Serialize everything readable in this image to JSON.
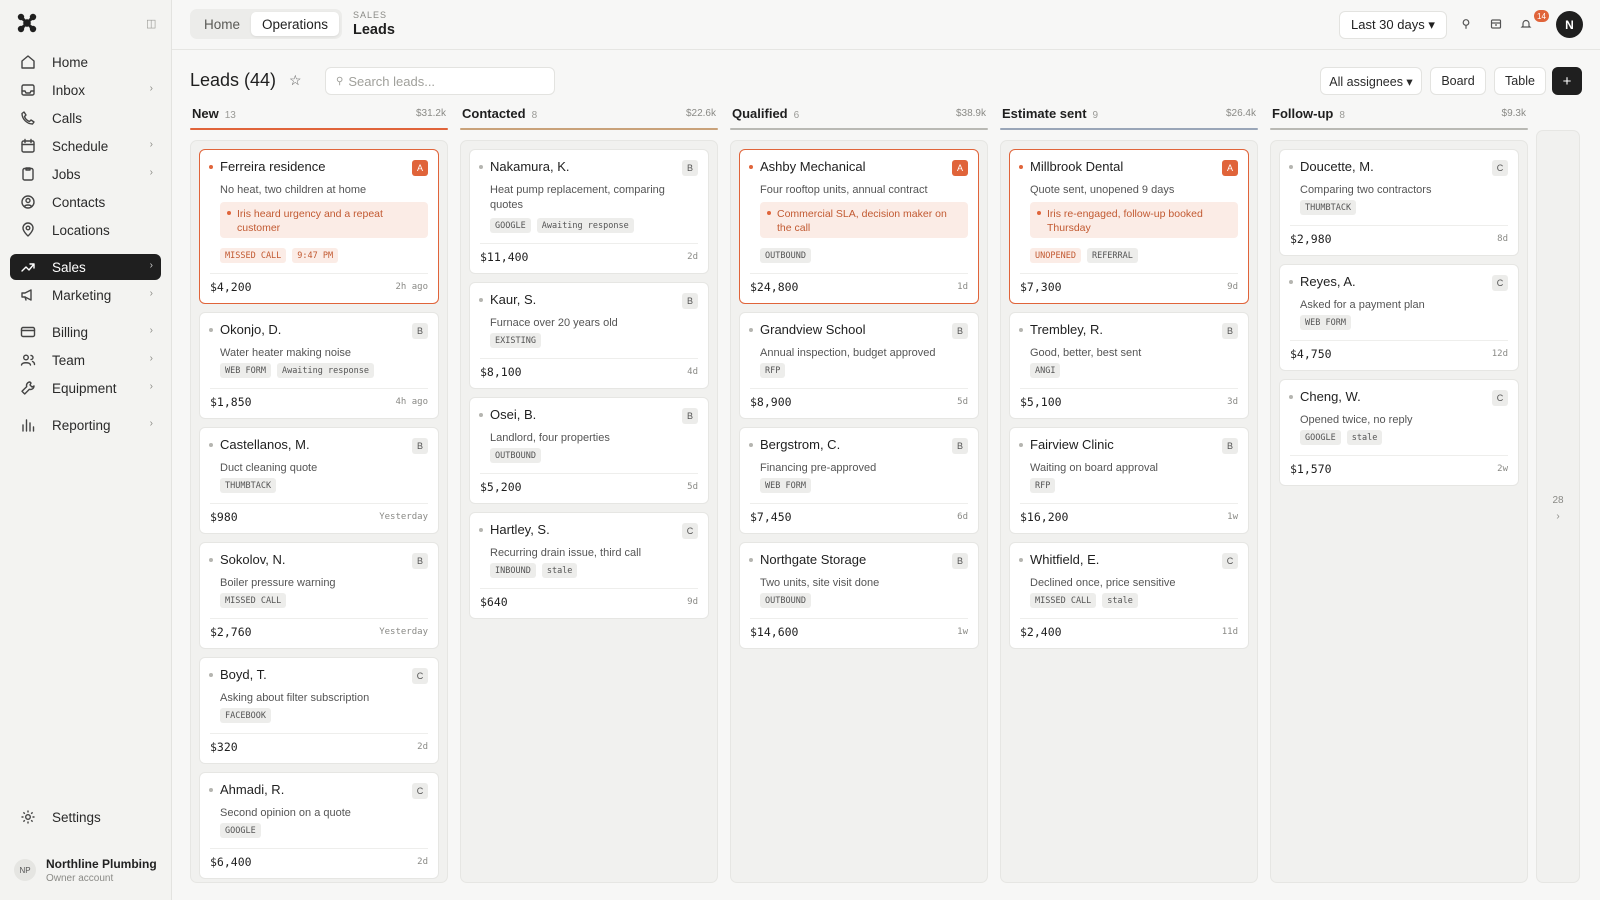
{
  "sidebar": {
    "nav": [
      {
        "label": "Home",
        "icon": "home-icon",
        "chevron": false
      },
      {
        "label": "Inbox",
        "icon": "inbox-icon",
        "chevron": true
      },
      {
        "label": "Calls",
        "icon": "phone-icon",
        "chevron": false
      },
      {
        "label": "Schedule",
        "icon": "calendar-icon",
        "chevron": true
      },
      {
        "label": "Jobs",
        "icon": "clipboard-icon",
        "chevron": true
      },
      {
        "label": "Contacts",
        "icon": "contacts-icon",
        "chevron": false
      },
      {
        "label": "Locations",
        "icon": "pin-icon",
        "chevron": false
      },
      {
        "label": "Sales",
        "icon": "trend-icon",
        "chevron": true,
        "active": true
      },
      {
        "label": "Marketing",
        "icon": "megaphone-icon",
        "chevron": true
      },
      {
        "label": "Billing",
        "icon": "card-icon",
        "chevron": true
      },
      {
        "label": "Team",
        "icon": "team-icon",
        "chevron": true
      },
      {
        "label": "Equipment",
        "icon": "wrench-icon",
        "chevron": true
      },
      {
        "label": "Reporting",
        "icon": "bar-chart-icon",
        "chevron": true
      }
    ],
    "settings_label": "Settings",
    "org_initials": "NP",
    "org_name": "Northline Plumbing",
    "org_role": "Owner account",
    "chevron": "›"
  },
  "topbar": {
    "tabs": [
      "Home",
      "Operations"
    ],
    "active_tab": 1,
    "crumb_kicker": "SALES",
    "crumb_title": "Leads",
    "range_label": "Last 30 days ▾",
    "notifications_count": "14",
    "user_initial": "N"
  },
  "page": {
    "title": "Leads (44)",
    "star": "☆",
    "search_placeholder": "Search leads...",
    "assignees_label": "All assignees ▾",
    "board_label": "Board",
    "table_label": "Table",
    "add_label": "+"
  },
  "columns": [
    {
      "name": "New",
      "count": "13",
      "total": "$31.2k",
      "color": "#e0643a",
      "cards": [
        {
          "title": "Ferreira residence",
          "priority": "A",
          "desc": "No heat, two children at home",
          "note": "Iris heard urgency and a repeat customer",
          "tags": [
            "MISSED CALL",
            "9:47 PM"
          ],
          "warm_tags": [],
          "amount": "$4,200",
          "age": "2h ago",
          "hot": true
        },
        {
          "title": "Okonjo, D.",
          "priority": "B",
          "desc": "Water heater making noise",
          "tags": [
            "WEB FORM",
            "Awaiting response"
          ],
          "amount": "$1,850",
          "age": "4h ago"
        },
        {
          "title": "Castellanos, M.",
          "priority": "B",
          "desc": "Duct cleaning quote",
          "tags": [
            "THUMBTACK"
          ],
          "amount": "$980",
          "age": "Yesterday"
        },
        {
          "title": "Sokolov, N.",
          "priority": "B",
          "desc": "Boiler pressure warning",
          "tags": [
            "MISSED CALL"
          ],
          "amount": "$2,760",
          "age": "Yesterday"
        },
        {
          "title": "Boyd, T.",
          "priority": "C",
          "desc": "Asking about filter subscription",
          "tags": [
            "FACEBOOK"
          ],
          "amount": "$320",
          "age": "2d"
        },
        {
          "title": "Ahmadi, R.",
          "priority": "C",
          "desc": "Second opinion on a quote",
          "tags": [
            "GOOGLE"
          ],
          "amount": "$6,400",
          "age": "2d"
        }
      ]
    },
    {
      "name": "Contacted",
      "count": "8",
      "total": "$22.6k",
      "color": "#c9a27a",
      "cards": [
        {
          "title": "Nakamura, K.",
          "priority": "B",
          "desc": "Heat pump replacement, comparing quotes",
          "tags": [
            "GOOGLE",
            "Awaiting response"
          ],
          "amount": "$11,400",
          "age": "2d",
          "tall_desc": true
        },
        {
          "title": "Kaur, S.",
          "priority": "B",
          "desc": "Furnace over 20 years old",
          "tags": [
            "EXISTING"
          ],
          "amount": "$8,100",
          "age": "4d"
        },
        {
          "title": "Osei, B.",
          "priority": "B",
          "desc": "Landlord, four properties",
          "tags": [
            "OUTBOUND"
          ],
          "amount": "$5,200",
          "age": "5d"
        },
        {
          "title": "Hartley, S.",
          "priority": "C",
          "desc": "Recurring drain issue, third call",
          "tags": [
            "INBOUND",
            "stale"
          ],
          "amount": "$640",
          "age": "9d"
        }
      ]
    },
    {
      "name": "Qualified",
      "count": "6",
      "total": "$38.9k",
      "color": "#b9b9b4",
      "cards": [
        {
          "title": "Ashby Mechanical",
          "priority": "A",
          "desc": "Four rooftop units, annual contract",
          "note": "Commercial SLA, decision maker on the call",
          "tags": [
            "OUTBOUND"
          ],
          "amount": "$24,800",
          "age": "1d",
          "hot": true
        },
        {
          "title": "Grandview School",
          "priority": "B",
          "desc": "Annual inspection, budget approved",
          "tags": [
            "RFP"
          ],
          "amount": "$8,900",
          "age": "5d"
        },
        {
          "title": "Bergstrom, C.",
          "priority": "B",
          "desc": "Financing pre-approved",
          "tags": [
            "WEB FORM"
          ],
          "amount": "$7,450",
          "age": "6d"
        },
        {
          "title": "Northgate Storage",
          "priority": "B",
          "desc": "Two units, site visit done",
          "tags": [
            "OUTBOUND"
          ],
          "amount": "$14,600",
          "age": "1w"
        }
      ]
    },
    {
      "name": "Estimate sent",
      "count": "9",
      "total": "$26.4k",
      "color": "#9aa6b8",
      "cards": [
        {
          "title": "Millbrook Dental",
          "priority": "A",
          "desc": "Quote sent, unopened 9 days",
          "note": "Iris re-engaged, follow-up booked Thursday",
          "tags": [
            "UNOPENED",
            "REFERRAL"
          ],
          "warm_tags": [
            "UNOPENED"
          ],
          "amount": "$7,300",
          "age": "9d",
          "hot": true
        },
        {
          "title": "Trembley, R.",
          "priority": "B",
          "desc": "Good, better, best sent",
          "tags": [
            "ANGI"
          ],
          "amount": "$5,100",
          "age": "3d"
        },
        {
          "title": "Fairview Clinic",
          "priority": "B",
          "desc": "Waiting on board approval",
          "tags": [
            "RFP"
          ],
          "amount": "$16,200",
          "age": "1w"
        },
        {
          "title": "Whitfield, E.",
          "priority": "C",
          "desc": "Declined once, price sensitive",
          "tags": [
            "MISSED CALL",
            "stale"
          ],
          "amount": "$2,400",
          "age": "11d"
        }
      ]
    },
    {
      "name": "Follow-up",
      "count": "8",
      "total": "$9.3k",
      "color": "#b9b9b4",
      "cards": [
        {
          "title": "Doucette, M.",
          "priority": "C",
          "desc": "Comparing two contractors",
          "tags": [
            "THUMBTACK"
          ],
          "amount": "$2,980",
          "age": "8d"
        },
        {
          "title": "Reyes, A.",
          "priority": "C",
          "desc": "Asked for a payment plan",
          "tags": [
            "WEB FORM"
          ],
          "amount": "$4,750",
          "age": "12d"
        },
        {
          "title": "Cheng, W.",
          "priority": "C",
          "desc": "Opened twice, no reply",
          "tags": [
            "GOOGLE",
            "stale"
          ],
          "amount": "$1,570",
          "age": "2w"
        }
      ]
    }
  ],
  "more_lanes": {
    "count": "28",
    "arrow": "›"
  }
}
